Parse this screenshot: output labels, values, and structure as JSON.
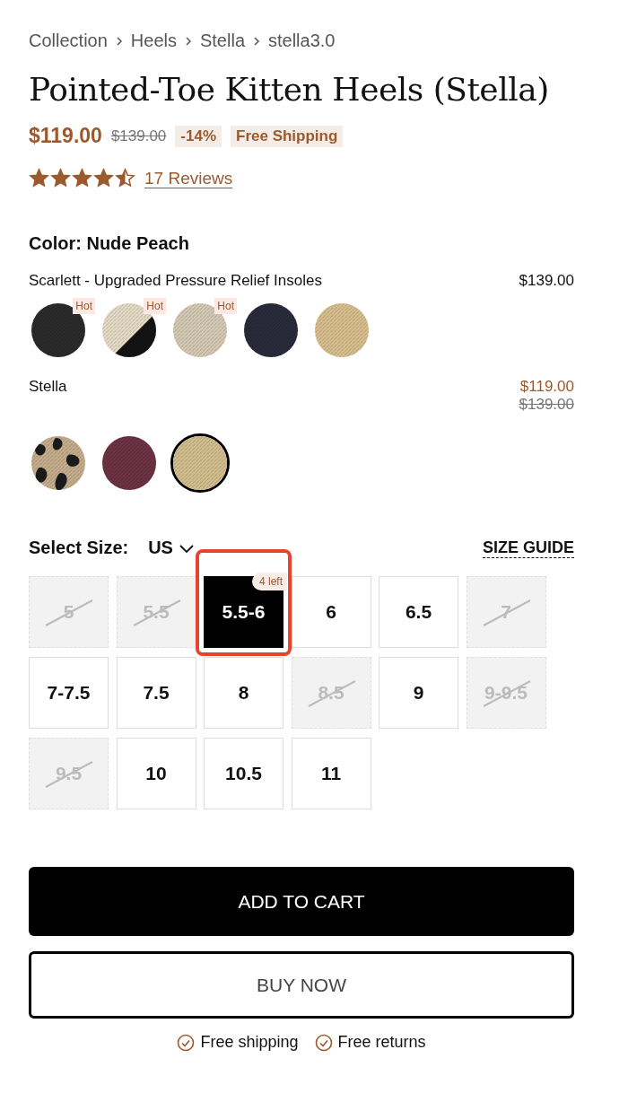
{
  "breadcrumb": [
    "Collection",
    "Heels",
    "Stella",
    "stella3.0"
  ],
  "title": "Pointed-Toe Kitten Heels (Stella)",
  "price": {
    "current": "$119.00",
    "original": "$139.00",
    "discount": "-14%",
    "shipping_badge": "Free Shipping"
  },
  "rating": {
    "stars": 4.5,
    "reviews": "17 Reviews"
  },
  "color_label": "Color: Nude Peach",
  "collections": [
    {
      "name": "Scarlett - Upgraded Pressure Relief Insoles",
      "price": "$139.00",
      "swatches": [
        {
          "kind": "solid",
          "color": "#2b2b2b",
          "badge": "Hot",
          "selected": false
        },
        {
          "kind": "split",
          "color": "#e8dfc8",
          "badge": "Hot",
          "selected": false
        },
        {
          "kind": "solid",
          "color": "#d9cdb8",
          "badge": "Hot",
          "selected": false
        },
        {
          "kind": "solid",
          "color": "#2a2c3c",
          "selected": false
        },
        {
          "kind": "solid",
          "color": "#dcc290",
          "selected": false
        }
      ]
    },
    {
      "name": "Stella",
      "price": "$119.00",
      "original_price": "$139.00",
      "swatches": [
        {
          "kind": "leopard",
          "color": "#c9b08f",
          "selected": false
        },
        {
          "kind": "solid",
          "color": "#6e3345",
          "selected": false
        },
        {
          "kind": "solid",
          "color": "#d6c291",
          "selected": true
        }
      ]
    }
  ],
  "size": {
    "label": "Select Size:",
    "unit": "US",
    "guide": "SIZE GUIDE",
    "sizes": [
      {
        "label": "5",
        "available": false,
        "selected": false
      },
      {
        "label": "5.5",
        "available": false,
        "selected": false
      },
      {
        "label": "5.5-6",
        "available": true,
        "selected": true,
        "stock": "4 left",
        "highlighted": true
      },
      {
        "label": "6",
        "available": true,
        "selected": false
      },
      {
        "label": "6.5",
        "available": true,
        "selected": false
      },
      {
        "label": "7",
        "available": false,
        "selected": false
      },
      {
        "label": "7-7.5",
        "available": true,
        "selected": false
      },
      {
        "label": "7.5",
        "available": true,
        "selected": false
      },
      {
        "label": "8",
        "available": true,
        "selected": false
      },
      {
        "label": "8.5",
        "available": false,
        "selected": false
      },
      {
        "label": "9",
        "available": true,
        "selected": false
      },
      {
        "label": "9-9.5",
        "available": false,
        "selected": false
      },
      {
        "label": "9.5",
        "available": false,
        "selected": false
      },
      {
        "label": "10",
        "available": true,
        "selected": false
      },
      {
        "label": "10.5",
        "available": true,
        "selected": false
      },
      {
        "label": "11",
        "available": true,
        "selected": false
      }
    ]
  },
  "buttons": {
    "add_to_cart": "ADD TO CART",
    "buy_now": "BUY NOW"
  },
  "perks": [
    "Free shipping",
    "Free returns"
  ]
}
